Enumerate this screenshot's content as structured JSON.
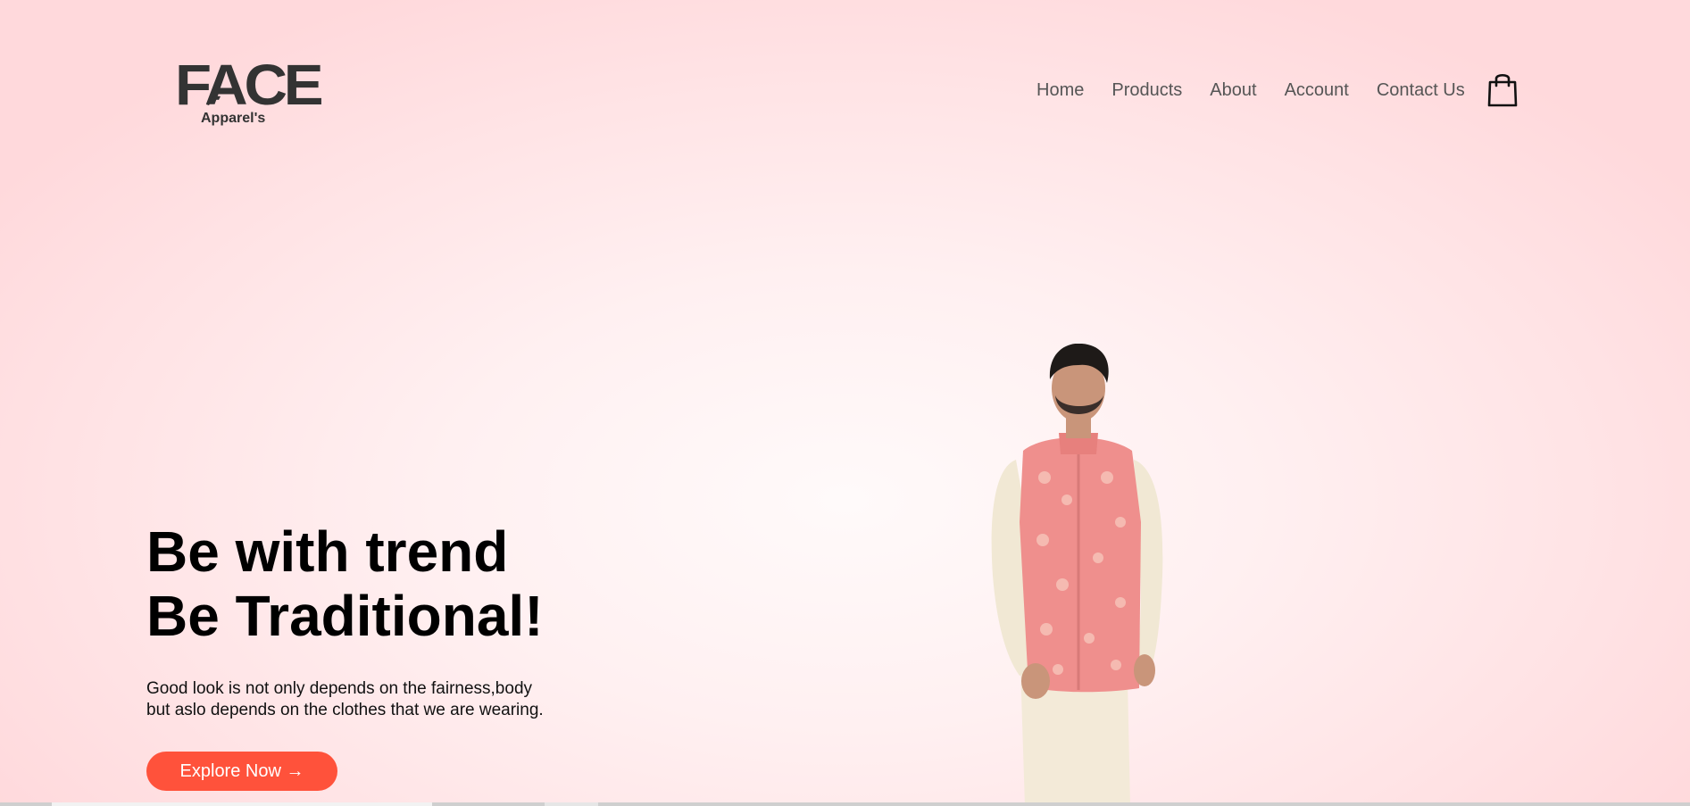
{
  "brand": {
    "name": "FACE",
    "tagline": "Apparel's"
  },
  "nav": {
    "items": [
      {
        "label": "Home"
      },
      {
        "label": "Products"
      },
      {
        "label": "About"
      },
      {
        "label": "Account"
      },
      {
        "label": "Contact Us"
      }
    ],
    "cart_icon": "shopping-bag-icon"
  },
  "hero": {
    "title_line1": "Be with trend",
    "title_line2": "Be Traditional!",
    "description_line1": "Good look is not only depends on the fairness,body",
    "description_line2": "but aslo depends on the clothes that we are wearing.",
    "cta_label": "Explore Now →"
  },
  "colors": {
    "accent": "#ff523b",
    "nav_text": "#555555",
    "logo": "#333333"
  }
}
